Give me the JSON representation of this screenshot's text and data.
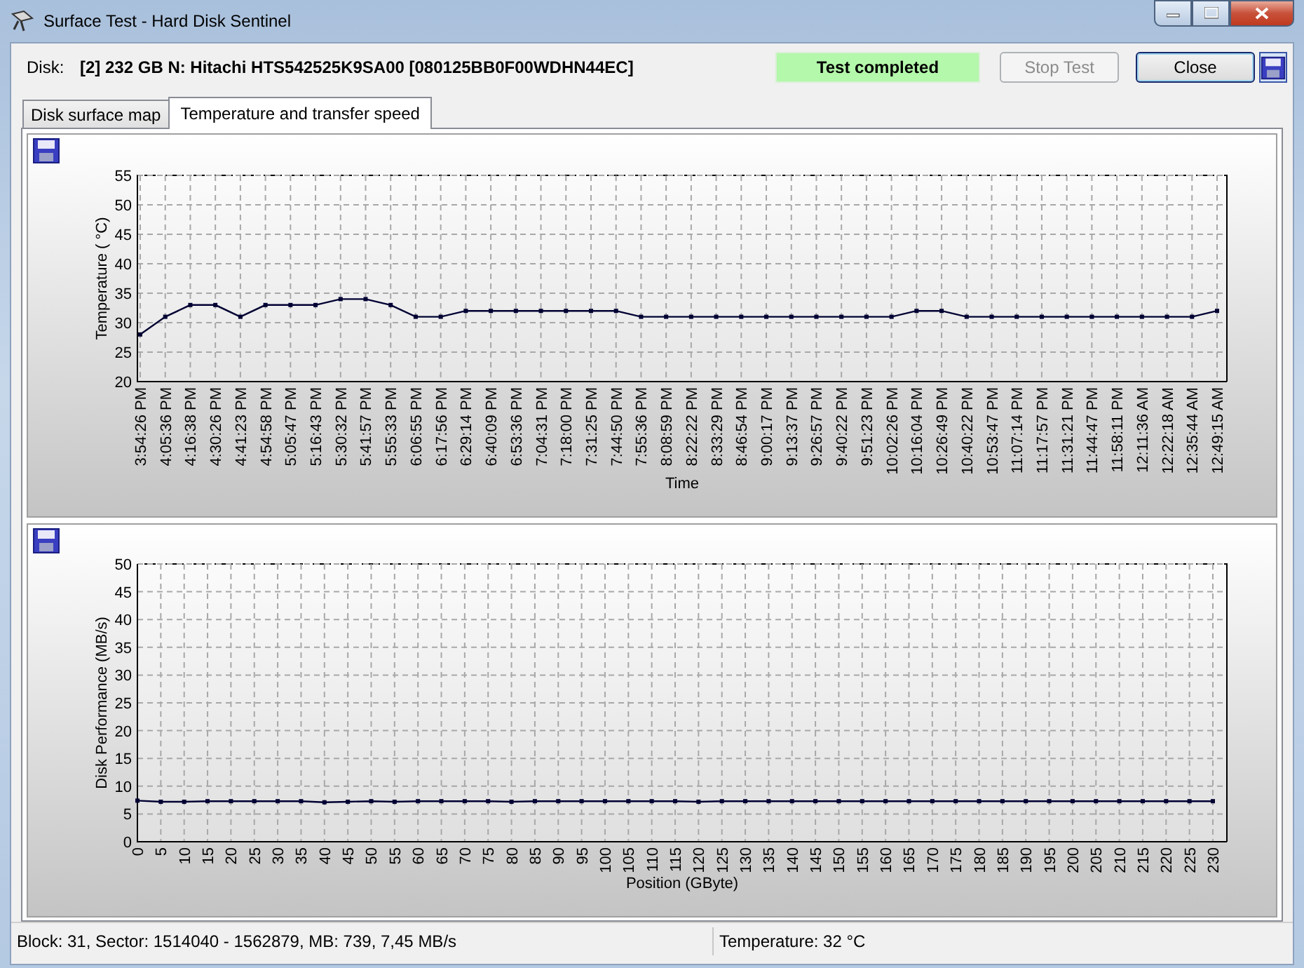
{
  "window": {
    "title": "Surface Test - Hard Disk Sentinel"
  },
  "disk": {
    "label": "Disk:",
    "value": "[2] 232 GB N: Hitachi HTS542525K9SA00 [080125BB0F00WDHN44EC]"
  },
  "test_status": {
    "text": "Test completed"
  },
  "buttons": [
    {
      "label": "Stop Test",
      "disabled": true
    },
    {
      "label": "Close",
      "disabled": false
    }
  ],
  "tabs": [
    {
      "label": "Disk surface map",
      "selected": false
    },
    {
      "label": "Temperature and transfer speed",
      "selected": true
    }
  ],
  "panels": [
    {
      "chart_data": {
        "type": "line",
        "xlabel": "Time",
        "ylabel": "Temperature ( °C)",
        "categories": [
          "3:54:26 PM",
          "4:05:36 PM",
          "4:16:38 PM",
          "4:30:26 PM",
          "4:41:23 PM",
          "4:54:58 PM",
          "5:05:47 PM",
          "5:16:43 PM",
          "5:30:32 PM",
          "5:41:57 PM",
          "5:55:33 PM",
          "6:06:55 PM",
          "6:17:56 PM",
          "6:29:14 PM",
          "6:40:09 PM",
          "6:53:36 PM",
          "7:04:31 PM",
          "7:18:00 PM",
          "7:31:25 PM",
          "7:44:50 PM",
          "7:55:36 PM",
          "8:08:59 PM",
          "8:22:22 PM",
          "8:33:29 PM",
          "8:46:54 PM",
          "9:00:17 PM",
          "9:13:37 PM",
          "9:26:57 PM",
          "9:40:22 PM",
          "9:51:23 PM",
          "10:02:26 PM",
          "10:16:04 PM",
          "10:26:49 PM",
          "10:40:22 PM",
          "10:53:47 PM",
          "11:07:14 PM",
          "11:17:57 PM",
          "11:31:21 PM",
          "11:44:47 PM",
          "11:58:11 PM",
          "12:11:36 AM",
          "12:22:18 AM",
          "12:35:44 AM",
          "12:49:15 AM"
        ],
        "grid": true,
        "series": [
          {
            "color": "#000033",
            "marker": "square",
            "values": [
              28,
              31,
              33,
              33,
              31,
              33,
              33,
              33,
              34,
              34,
              33,
              31,
              31,
              32,
              32,
              32,
              32,
              32,
              32,
              32,
              31,
              31,
              31,
              31,
              31,
              31,
              31,
              31,
              31,
              31,
              31,
              32,
              32,
              31,
              31,
              31,
              31,
              31,
              31,
              31,
              31,
              31,
              31,
              32
            ]
          }
        ],
        "ylim": [
          20,
          55
        ],
        "yticks": [
          20,
          25,
          30,
          35,
          40,
          45,
          50,
          55
        ]
      }
    },
    {
      "chart_data": {
        "type": "line",
        "xlabel": "Position (GByte)",
        "ylabel": "Disk Performance (MB/s)",
        "x": [
          0,
          5,
          10,
          15,
          20,
          25,
          30,
          35,
          40,
          45,
          50,
          55,
          60,
          65,
          70,
          75,
          80,
          85,
          90,
          95,
          100,
          105,
          110,
          115,
          120,
          125,
          130,
          135,
          140,
          145,
          150,
          155,
          160,
          165,
          170,
          175,
          180,
          185,
          190,
          195,
          200,
          205,
          210,
          215,
          220,
          225,
          230
        ],
        "grid": true,
        "series": [
          {
            "color": "#000033",
            "marker": "square",
            "values": [
              7.4,
              7.2,
              7.2,
              7.3,
              7.3,
              7.3,
              7.3,
              7.3,
              7.1,
              7.2,
              7.3,
              7.2,
              7.3,
              7.3,
              7.3,
              7.3,
              7.2,
              7.3,
              7.3,
              7.3,
              7.3,
              7.3,
              7.3,
              7.3,
              7.2,
              7.3,
              7.3,
              7.3,
              7.3,
              7.3,
              7.3,
              7.3,
              7.3,
              7.3,
              7.3,
              7.3,
              7.3,
              7.3,
              7.3,
              7.3,
              7.3,
              7.3,
              7.3,
              7.3,
              7.3,
              7.3,
              7.3
            ]
          }
        ],
        "xlim": [
          0,
          233
        ],
        "xticks": [
          0,
          5,
          10,
          15,
          20,
          25,
          30,
          35,
          40,
          45,
          50,
          55,
          60,
          65,
          70,
          75,
          80,
          85,
          90,
          95,
          100,
          105,
          110,
          115,
          120,
          125,
          130,
          135,
          140,
          145,
          150,
          155,
          160,
          165,
          170,
          175,
          180,
          185,
          190,
          195,
          200,
          205,
          210,
          215,
          220,
          225,
          230
        ],
        "ylim": [
          0,
          50
        ],
        "yticks": [
          0,
          5,
          10,
          15,
          20,
          25,
          30,
          35,
          40,
          45,
          50
        ]
      }
    }
  ],
  "status_bar": [
    {
      "text": "Block: 31, Sector: 1514040 - 1562879, MB: 739, 7,45 MB/s"
    },
    {
      "text": "Temperature: 32  °C"
    }
  ]
}
